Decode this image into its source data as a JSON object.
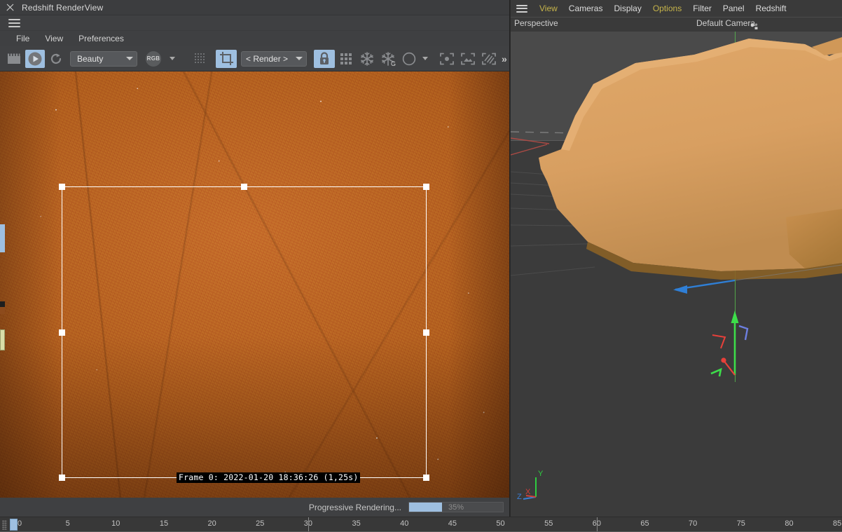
{
  "renderview": {
    "title": "Redshift RenderView",
    "close_icon": "close-icon",
    "hamburger_icon": "hamburger-menu-icon",
    "menus": [
      {
        "label": "File"
      },
      {
        "label": "View"
      },
      {
        "label": "Preferences"
      }
    ],
    "toolbar": {
      "items": [
        {
          "name": "clapperboard-icon",
          "kind": "icon",
          "label": "",
          "highlighted": false
        },
        {
          "name": "play-render-icon",
          "kind": "icon",
          "label": "",
          "highlighted": true
        },
        {
          "name": "refresh-reload-icon",
          "kind": "icon",
          "label": "",
          "highlighted": false
        },
        {
          "name": "aov-select-combo",
          "kind": "combo",
          "label": "Beauty",
          "highlighted": false
        },
        {
          "name": "rgb-channel-icon",
          "kind": "rgb",
          "label": "RGB",
          "highlighted": false
        },
        {
          "name": "rgb-channel-caret",
          "kind": "caret",
          "label": "",
          "highlighted": false
        },
        {
          "name": "alpha-grid-icon",
          "kind": "icon",
          "label": "",
          "highlighted": false
        },
        {
          "name": "crop-region-icon",
          "kind": "icon",
          "label": "",
          "highlighted": true
        },
        {
          "name": "render-scope-combo",
          "kind": "combo2",
          "label": "< Render >",
          "highlighted": false
        },
        {
          "name": "lock-icon",
          "kind": "icon",
          "label": "",
          "highlighted": true
        },
        {
          "name": "grid-squares-icon",
          "kind": "icon",
          "label": "",
          "highlighted": false
        },
        {
          "name": "denoise-snowflake-icon",
          "kind": "icon",
          "label": "",
          "highlighted": false
        },
        {
          "name": "denoise-snowflake-g-icon",
          "kind": "icon",
          "label": "G",
          "highlighted": false
        },
        {
          "name": "circle-tonemap-icon",
          "kind": "icon",
          "label": "",
          "highlighted": false
        },
        {
          "name": "tonemap-caret",
          "kind": "caret",
          "label": "",
          "highlighted": false
        },
        {
          "name": "focus-target-icon",
          "kind": "icon",
          "label": "",
          "highlighted": false
        },
        {
          "name": "fit-image-icon",
          "kind": "icon",
          "label": "",
          "highlighted": false
        },
        {
          "name": "compare-ab-icon",
          "kind": "icon",
          "label": "",
          "highlighted": false
        },
        {
          "name": "toolbar-overflow-icon",
          "kind": "more",
          "label": "»",
          "highlighted": false
        }
      ]
    },
    "frame_stamp": "Frame  0: 2022-01-20  18:36:26  (1,25s)",
    "status": {
      "message": "Progressive Rendering...",
      "progress_percent": 35,
      "progress_label": "35%"
    },
    "colors": {
      "highlight": "#9ebfe0",
      "panel": "#3f4042",
      "render_orange": "#b4621f"
    }
  },
  "viewport": {
    "menus": [
      {
        "label": "View",
        "accent": true
      },
      {
        "label": "Cameras",
        "accent": false
      },
      {
        "label": "Display",
        "accent": false
      },
      {
        "label": "Options",
        "accent": true
      },
      {
        "label": "Filter",
        "accent": false
      },
      {
        "label": "Panel",
        "accent": false
      },
      {
        "label": "Redshift",
        "accent": false
      }
    ],
    "hamburger_icon": "hamburger-menu-icon",
    "view_label": "Perspective",
    "camera_label": "Default Camera",
    "camera_icon": "camera-icon",
    "axis_triad": {
      "x": "X",
      "y": "Y",
      "z": "Z"
    },
    "colors": {
      "menu_accent": "#c6b44a",
      "axis_x": "#d2403a",
      "axis_y": "#57b84e",
      "axis_z": "#2f7fd6",
      "mesh": "#dba062"
    }
  },
  "timeline": {
    "current_frame": 0,
    "ticks": [
      {
        "value": 0,
        "label": "0"
      },
      {
        "value": 5,
        "label": "5"
      },
      {
        "value": 10,
        "label": "10"
      },
      {
        "value": 15,
        "label": "15"
      },
      {
        "value": 20,
        "label": "20"
      },
      {
        "value": 25,
        "label": "25"
      },
      {
        "value": 30,
        "label": "30"
      },
      {
        "value": 35,
        "label": "35"
      },
      {
        "value": 40,
        "label": "40"
      },
      {
        "value": 45,
        "label": "45"
      },
      {
        "value": 50,
        "label": "50"
      },
      {
        "value": 55,
        "label": "55"
      },
      {
        "value": 60,
        "label": "60"
      },
      {
        "value": 65,
        "label": "65"
      },
      {
        "value": 70,
        "label": "70"
      },
      {
        "value": 75,
        "label": "75"
      },
      {
        "value": 80,
        "label": "80"
      },
      {
        "value": 85,
        "label": "85"
      }
    ]
  }
}
